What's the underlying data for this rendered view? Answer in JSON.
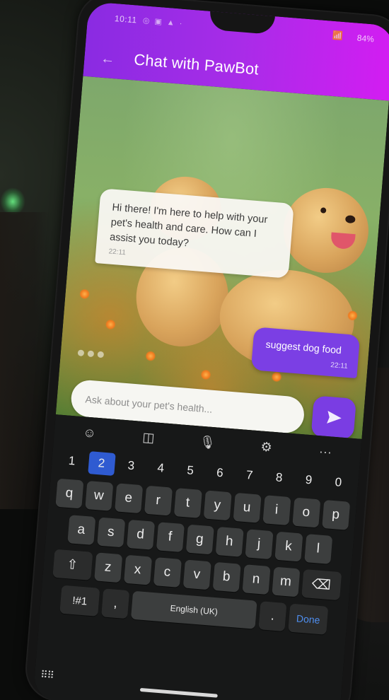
{
  "status_bar": {
    "time": "10:11",
    "battery": "84%"
  },
  "header": {
    "title": "Chat with PawBot"
  },
  "messages": [
    {
      "sender": "bot",
      "text": "Hi there! I'm here to help with your pet's health and care. How can I assist you today?",
      "time": "22:11"
    },
    {
      "sender": "user",
      "text": "suggest dog food",
      "time": "22:11"
    }
  ],
  "input": {
    "placeholder": "Ask about your pet's health...",
    "value": ""
  },
  "keyboard": {
    "number_row": [
      "1",
      "2",
      "3",
      "4",
      "5",
      "6",
      "7",
      "8",
      "9",
      "0"
    ],
    "row1": [
      "q",
      "w",
      "e",
      "r",
      "t",
      "y",
      "u",
      "i",
      "o",
      "p"
    ],
    "row2": [
      "a",
      "s",
      "d",
      "f",
      "g",
      "h",
      "j",
      "k",
      "l"
    ],
    "row3": [
      "z",
      "x",
      "c",
      "v",
      "b",
      "n",
      "m"
    ],
    "symbols_label": "!#1",
    "comma_label": ",",
    "space_label": "English (UK)",
    "period_label": ".",
    "done_label": "Done"
  },
  "colors": {
    "header_start": "#8a2be2",
    "header_end": "#d31df2",
    "user_bubble": "#7b3fe4",
    "send_button": "#7a3de3",
    "done_text": "#4f8ff0"
  },
  "icons": {
    "send": "send-icon",
    "emoji": "emoji-icon",
    "sticker": "sticker-icon",
    "mic": "microphone-icon",
    "settings": "gear-icon",
    "more": "more-icon",
    "shift": "shift-icon",
    "backspace": "backspace-icon"
  }
}
